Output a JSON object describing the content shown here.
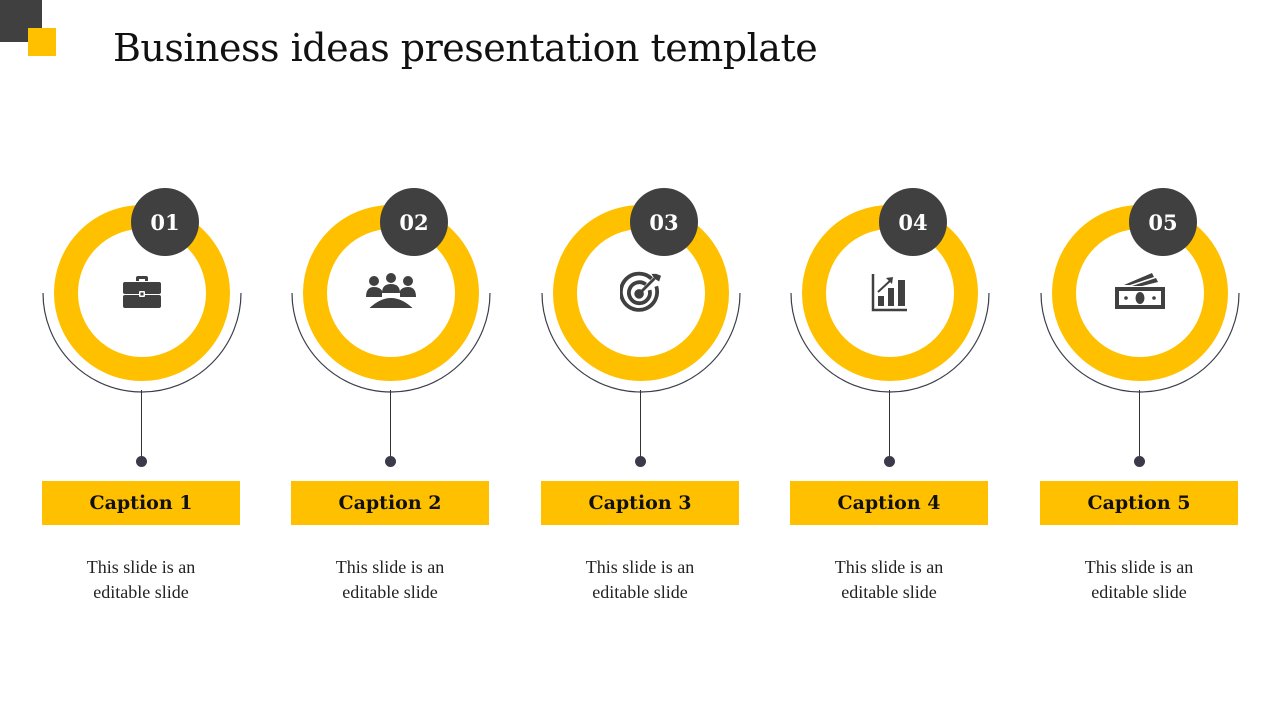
{
  "title": "Business ideas presentation template",
  "colors": {
    "accent": "#FFC000",
    "dark": "#404040",
    "line": "#333333"
  },
  "steps": [
    {
      "number": "01",
      "icon": "briefcase-icon",
      "caption": "Caption 1",
      "description_line1": "This slide is an",
      "description_line2": "editable slide"
    },
    {
      "number": "02",
      "icon": "team-meeting-icon",
      "caption": "Caption 2",
      "description_line1": "This slide is an",
      "description_line2": "editable slide"
    },
    {
      "number": "03",
      "icon": "target-icon",
      "caption": "Caption 3",
      "description_line1": "This slide is an",
      "description_line2": "editable slide"
    },
    {
      "number": "04",
      "icon": "growth-chart-icon",
      "caption": "Caption 4",
      "description_line1": "This slide is an",
      "description_line2": "editable slide"
    },
    {
      "number": "05",
      "icon": "money-icon",
      "caption": "Caption 5",
      "description_line1": "This slide is an",
      "description_line2": "editable slide"
    }
  ]
}
